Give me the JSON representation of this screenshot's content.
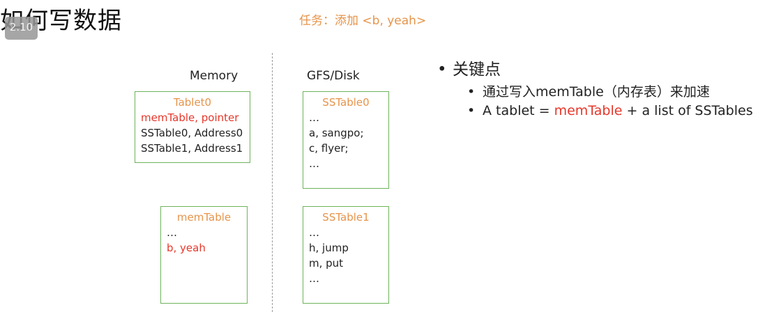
{
  "slide": {
    "title": "如何写数据",
    "badge": "2.10",
    "task": "任务：添加 <b, yeah>",
    "memory_label": "Memory",
    "disk_label": "GFS/Disk"
  },
  "tablet0": {
    "title": "Tablet0",
    "lines": [
      "memTable, pointer",
      "SSTable0, Address0",
      "SSTable1, Address1"
    ]
  },
  "memtable": {
    "title": "memTable",
    "lines": [
      "…",
      "b, yeah"
    ]
  },
  "sstable0": {
    "title": "SSTable0",
    "lines": [
      "…",
      "a, sangpo;",
      "c, flyer;",
      "…"
    ]
  },
  "sstable1": {
    "title": "SSTable1",
    "lines": [
      "…",
      "h, jump",
      "m, put",
      "…"
    ]
  },
  "keypoints": {
    "heading": "关键点",
    "bullet_main": "•",
    "bullet_sub": "•",
    "item1": "通过写入memTable（内存表）来加速",
    "item2_pre": "A tablet = ",
    "item2_hl": "memTable",
    "item2_post": " + a list of SSTables"
  },
  "colors": {
    "orange": "#e6944a",
    "red": "#e6372a",
    "green": "#6db35b"
  }
}
